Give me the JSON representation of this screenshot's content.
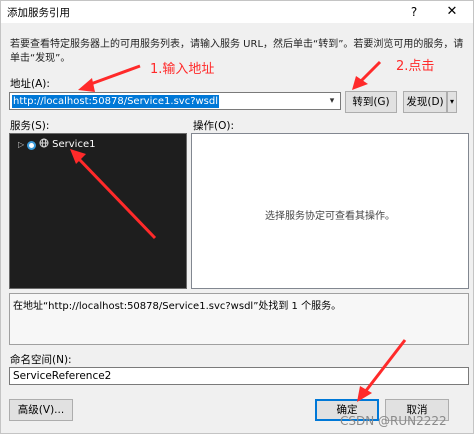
{
  "window": {
    "title": "添加服务引用",
    "help_glyph": "?",
    "close_glyph": "✕"
  },
  "instructions": "若要查看特定服务器上的可用服务列表，请输入服务 URL，然后单击“转到”。若要浏览可用的服务，请单击“发现”。",
  "address": {
    "label": "地址(A):",
    "value": "http://localhost:50878/Service1.svc?wsdl"
  },
  "buttons": {
    "go": "转到(G)",
    "discover": "发现(D)",
    "advanced": "高级(V)...",
    "ok": "确定",
    "cancel": "取消"
  },
  "services": {
    "label": "服务(S):",
    "items": [
      {
        "name": "Service1"
      }
    ]
  },
  "operations": {
    "label": "操作(O):",
    "empty_message": "选择服务协定可查看其操作。"
  },
  "status": "在地址“http://localhost:50878/Service1.svc?wsdl”处找到 1 个服务。",
  "namespace": {
    "label": "命名空间(N):",
    "value": "ServiceReference2"
  },
  "annotations": {
    "step1": "1.输入地址",
    "step2": "2.点击",
    "color": "#ff2a2a"
  },
  "watermark": "CSDN @RUN2222"
}
